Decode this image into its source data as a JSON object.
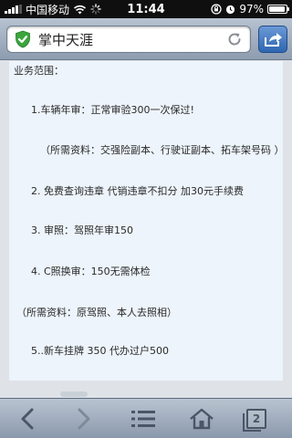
{
  "status_bar": {
    "carrier": "中国移动",
    "time": "11:44",
    "battery": "97%",
    "signal_bars": 4,
    "battery_level": 0.97
  },
  "browser": {
    "page_title": "掌中天涯"
  },
  "content": {
    "lines": [
      "业务范围：",
      "1.车辆年审：正常审验300一次保过!",
      "（所需资料：交强险副本、行驶证副本、拓车架号码 ）",
      "2. 免费查询违章 代销违章不扣分 加30元手续费",
      "3. 审照：驾照年审150",
      "4. C照换审：150无需体检",
      "（所需资料：原驾照、本人去照相）",
      "5..新车挂牌 350 代办过户500"
    ]
  },
  "bottom_bar": {
    "tab_count": "2"
  },
  "colors": {
    "accent": "#2e66b1",
    "shield": "#3aa53c",
    "icon": "#4a5666"
  }
}
